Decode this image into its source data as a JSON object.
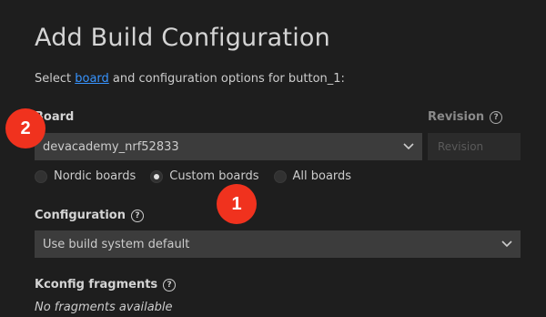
{
  "header": {
    "title": "Add Build Configuration"
  },
  "subtitle": {
    "prefix": "Select ",
    "link": "board",
    "suffix": " and configuration options for button_1:"
  },
  "board": {
    "label": "Board",
    "selected": "devacademy_nrf52833",
    "options": [
      {
        "label": "Nordic boards",
        "checked": false
      },
      {
        "label": "Custom boards",
        "checked": true
      },
      {
        "label": "All boards",
        "checked": false
      }
    ]
  },
  "revision": {
    "label": "Revision",
    "placeholder": "Revision"
  },
  "configuration": {
    "label": "Configuration",
    "selected": "Use build system default"
  },
  "kconfig": {
    "label": "Kconfig fragments",
    "empty_text": "No fragments available"
  },
  "annotations": [
    {
      "text": "2"
    },
    {
      "text": "1"
    }
  ],
  "colors": {
    "background": "#1e1e1e",
    "link": "#3794ff",
    "badge": "#f0321e"
  },
  "icons": {
    "help": "help-circle-icon",
    "chevron": "chevron-down-icon"
  }
}
